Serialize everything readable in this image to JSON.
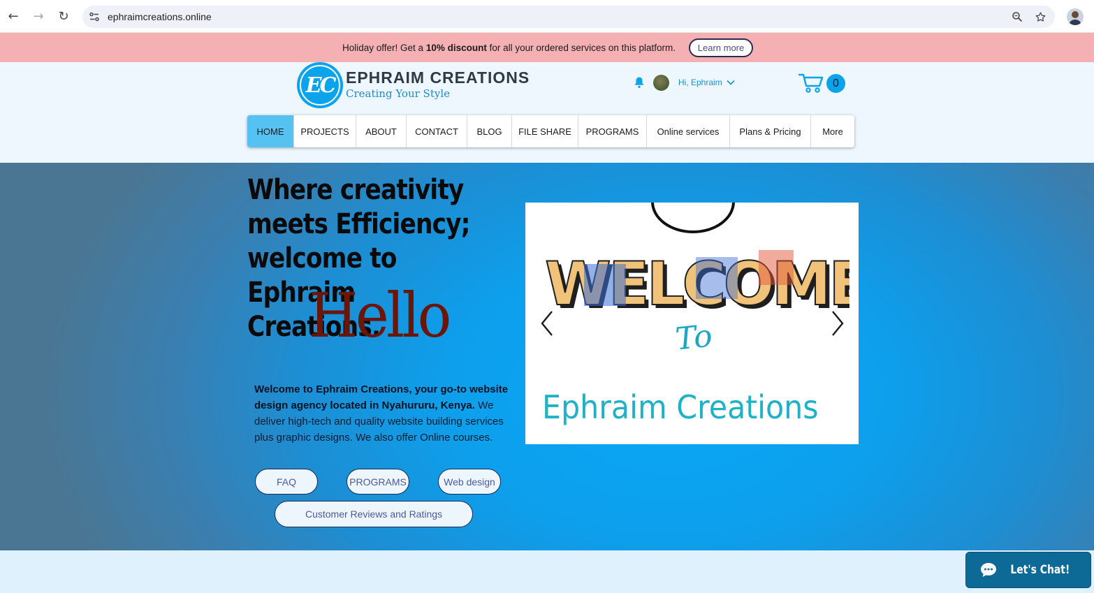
{
  "browser": {
    "url": "ephraimcreations.online",
    "back_icon": "←",
    "forward_icon": "→",
    "reload_icon": "↻"
  },
  "promo": {
    "text_before": "Holiday offer! Get a ",
    "text_bold": "10% discount",
    "text_after": " for all your ordered services on this platform.",
    "button_label": "Learn more",
    "background_color": "#f4b0b3"
  },
  "header": {
    "logo_monogram": "EC",
    "brand_name": "EPHRAIM CREATIONS",
    "tagline": "Creating Your Style",
    "greeting": "Hi, Ephraim",
    "cart_count": "0",
    "accent_color": "#0aa3ec"
  },
  "menu": {
    "items": [
      {
        "label": "HOME",
        "active": true
      },
      {
        "label": "PROJECTS",
        "active": false
      },
      {
        "label": "ABOUT",
        "active": false
      },
      {
        "label": "CONTACT",
        "active": false
      },
      {
        "label": "BLOG",
        "active": false
      },
      {
        "label": "FILE SHARE",
        "active": false
      },
      {
        "label": "PROGRAMS",
        "active": false
      },
      {
        "label": "Online services",
        "active": false
      },
      {
        "label": "Plans & Pricing",
        "active": false
      },
      {
        "label": "More",
        "active": false
      }
    ]
  },
  "hero": {
    "title": "Where creativity meets Efficiency; welcome to Ephraim Creations.",
    "hello": "Hello",
    "description_strong": "Welcome to Ephraim Creations, your go-to website design agency located in Nyahururu, Kenya.",
    "description_rest": " We deliver high-tech and quality website building services plus graphic designs. We also offer Online courses.",
    "buttons": {
      "faq": "FAQ",
      "programs": "PROGRAMS",
      "web_design": "Web design",
      "reviews": "Customer Reviews and Ratings"
    }
  },
  "slideshow": {
    "welcome_text": "WELCOME",
    "to_text": "To",
    "brand_text": "Ephraim Creations"
  },
  "chat": {
    "label": "Let's Chat!"
  }
}
